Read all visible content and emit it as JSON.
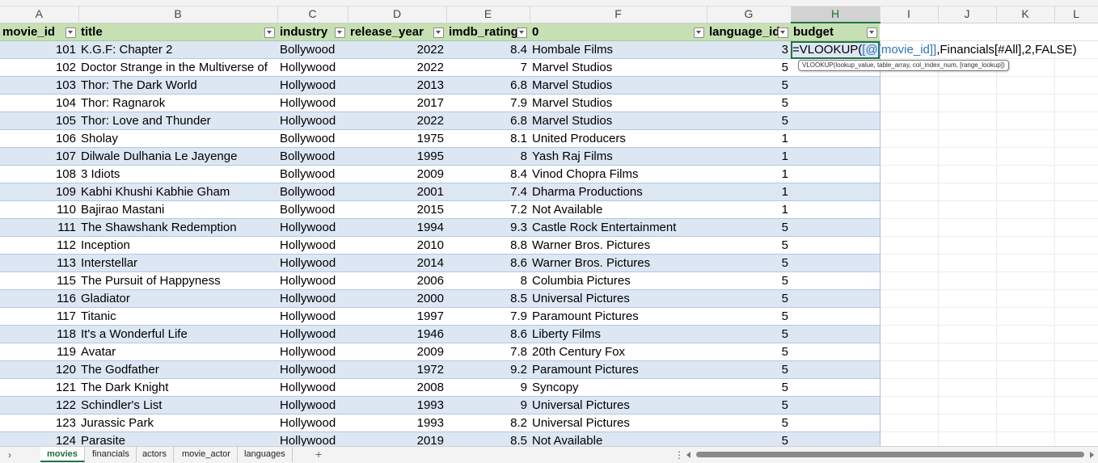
{
  "columns": [
    "A",
    "B",
    "C",
    "D",
    "E",
    "F",
    "G",
    "H",
    "I",
    "J",
    "K",
    "L"
  ],
  "headers": [
    "movie_id",
    "title",
    "industry",
    "release_year",
    "imdb_rating",
    "0",
    "language_id",
    "budget"
  ],
  "active_cell": {
    "prefix": "=VLOOKUP(",
    "ref_part": "[@[movie_id]]",
    "suffix": ",Financials[#All],2,FALSE)",
    "tooltip": "VLOOKUP(lookup_value, table_array, col_index_num, [range_lookup])"
  },
  "rows": [
    {
      "movie_id": "101",
      "title": "K.G.F: Chapter 2",
      "industry": "Bollywood",
      "release_year": "2022",
      "imdb_rating": "8.4",
      "studio": "Hombale Films",
      "language_id": "3"
    },
    {
      "movie_id": "102",
      "title": "Doctor Strange in the Multiverse of",
      "industry": "Hollywood",
      "release_year": "2022",
      "imdb_rating": "7",
      "studio": "Marvel Studios",
      "language_id": "5"
    },
    {
      "movie_id": "103",
      "title": "Thor: The Dark World",
      "industry": "Hollywood",
      "release_year": "2013",
      "imdb_rating": "6.8",
      "studio": "Marvel Studios",
      "language_id": "5"
    },
    {
      "movie_id": "104",
      "title": "Thor: Ragnarok",
      "industry": "Hollywood",
      "release_year": "2017",
      "imdb_rating": "7.9",
      "studio": "Marvel Studios",
      "language_id": "5"
    },
    {
      "movie_id": "105",
      "title": "Thor: Love and Thunder",
      "industry": "Hollywood",
      "release_year": "2022",
      "imdb_rating": "6.8",
      "studio": "Marvel Studios",
      "language_id": "5"
    },
    {
      "movie_id": "106",
      "title": "Sholay",
      "industry": "Bollywood",
      "release_year": "1975",
      "imdb_rating": "8.1",
      "studio": "United Producers",
      "language_id": "1"
    },
    {
      "movie_id": "107",
      "title": "Dilwale Dulhania Le Jayenge",
      "industry": "Bollywood",
      "release_year": "1995",
      "imdb_rating": "8",
      "studio": "Yash Raj Films",
      "language_id": "1"
    },
    {
      "movie_id": "108",
      "title": "3 Idiots",
      "industry": "Bollywood",
      "release_year": "2009",
      "imdb_rating": "8.4",
      "studio": "Vinod Chopra Films",
      "language_id": "1"
    },
    {
      "movie_id": "109",
      "title": "Kabhi Khushi Kabhie Gham",
      "industry": "Bollywood",
      "release_year": "2001",
      "imdb_rating": "7.4",
      "studio": "Dharma Productions",
      "language_id": "1"
    },
    {
      "movie_id": "110",
      "title": "Bajirao Mastani",
      "industry": "Bollywood",
      "release_year": "2015",
      "imdb_rating": "7.2",
      "studio": "Not Available",
      "language_id": "1"
    },
    {
      "movie_id": "111",
      "title": "The Shawshank Redemption",
      "industry": "Hollywood",
      "release_year": "1994",
      "imdb_rating": "9.3",
      "studio": "Castle Rock Entertainment",
      "language_id": "5"
    },
    {
      "movie_id": "112",
      "title": "Inception",
      "industry": "Hollywood",
      "release_year": "2010",
      "imdb_rating": "8.8",
      "studio": "Warner Bros. Pictures",
      "language_id": "5"
    },
    {
      "movie_id": "113",
      "title": "Interstellar",
      "industry": "Hollywood",
      "release_year": "2014",
      "imdb_rating": "8.6",
      "studio": "Warner Bros. Pictures",
      "language_id": "5"
    },
    {
      "movie_id": "115",
      "title": "The Pursuit of Happyness",
      "industry": "Hollywood",
      "release_year": "2006",
      "imdb_rating": "8",
      "studio": "Columbia Pictures",
      "language_id": "5"
    },
    {
      "movie_id": "116",
      "title": "Gladiator",
      "industry": "Hollywood",
      "release_year": "2000",
      "imdb_rating": "8.5",
      "studio": "Universal Pictures",
      "language_id": "5"
    },
    {
      "movie_id": "117",
      "title": "Titanic",
      "industry": "Hollywood",
      "release_year": "1997",
      "imdb_rating": "7.9",
      "studio": "Paramount Pictures",
      "language_id": "5"
    },
    {
      "movie_id": "118",
      "title": "It's a Wonderful Life",
      "industry": "Hollywood",
      "release_year": "1946",
      "imdb_rating": "8.6",
      "studio": "Liberty Films",
      "language_id": "5"
    },
    {
      "movie_id": "119",
      "title": "Avatar",
      "industry": "Hollywood",
      "release_year": "2009",
      "imdb_rating": "7.8",
      "studio": "20th Century Fox",
      "language_id": "5"
    },
    {
      "movie_id": "120",
      "title": "The Godfather",
      "industry": "Hollywood",
      "release_year": "1972",
      "imdb_rating": "9.2",
      "studio": "Paramount Pictures",
      "language_id": "5"
    },
    {
      "movie_id": "121",
      "title": "The Dark Knight",
      "industry": "Hollywood",
      "release_year": "2008",
      "imdb_rating": "9",
      "studio": "Syncopy",
      "language_id": "5"
    },
    {
      "movie_id": "122",
      "title": "Schindler's List",
      "industry": "Hollywood",
      "release_year": "1993",
      "imdb_rating": "9",
      "studio": "Universal Pictures",
      "language_id": "5"
    },
    {
      "movie_id": "123",
      "title": "Jurassic Park",
      "industry": "Hollywood",
      "release_year": "1993",
      "imdb_rating": "8.2",
      "studio": "Universal Pictures",
      "language_id": "5"
    },
    {
      "movie_id": "124",
      "title": "Parasite",
      "industry": "Hollywood",
      "release_year": "2019",
      "imdb_rating": "8.5",
      "studio": "Not Available",
      "language_id": "5"
    }
  ],
  "sheet_tabs": [
    "movies",
    "financials",
    "actors",
    "movie_actor",
    "languages"
  ],
  "active_sheet": "movies",
  "icons": {
    "tab_nav": "chevron-right-icon",
    "add_sheet": "plus-icon",
    "filter": "filter-dropdown-icon",
    "more": "more-options-icon"
  },
  "colors": {
    "accent": "#217346",
    "header_fill": "#c6e0b4",
    "band_fill": "#dde7f3",
    "ref_color": "#2f75b5"
  }
}
